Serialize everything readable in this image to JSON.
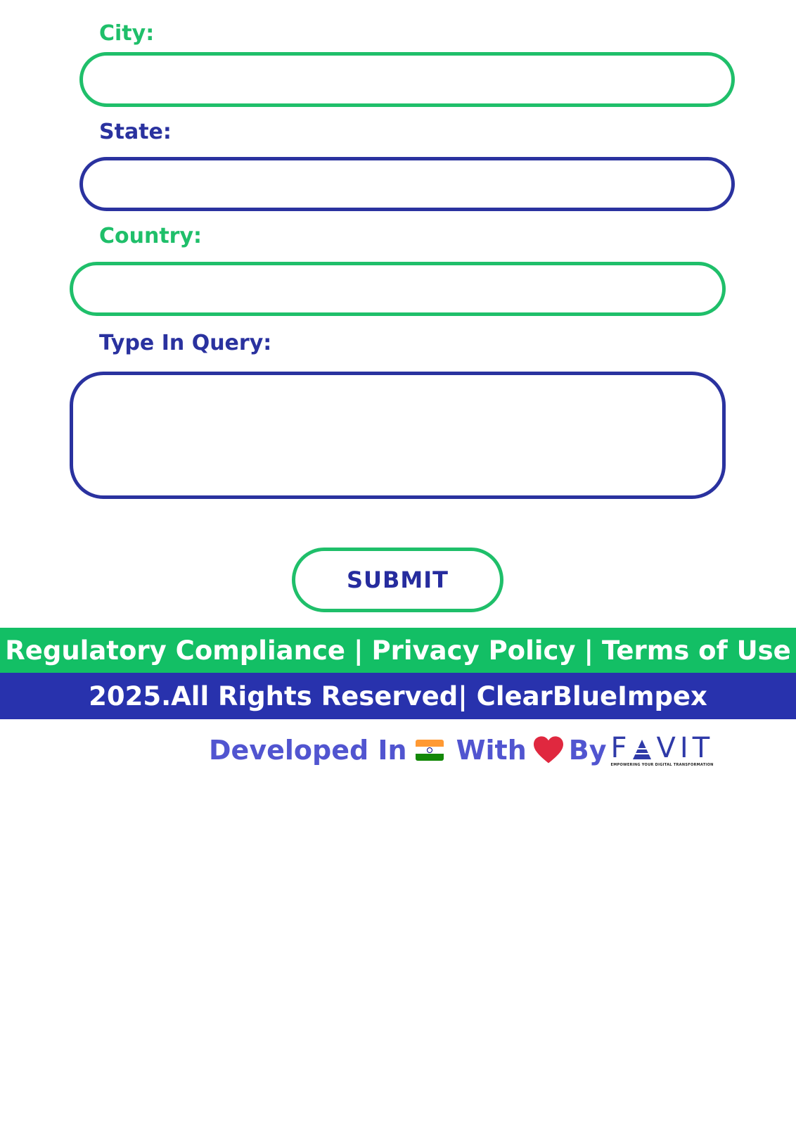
{
  "form": {
    "city_label": "City:",
    "city_value": "",
    "state_label": "State:",
    "state_value": "",
    "country_label": "Country:",
    "country_value": "",
    "query_label": "Type In Query:",
    "query_value": "",
    "submit_label": "SUBMIT"
  },
  "footer": {
    "links": [
      "Regulatory Compliance",
      "Privacy Policy",
      "Terms of Use"
    ],
    "separator": "|",
    "copyright": "2025.All Rights Reserved| ClearBlueImpex"
  },
  "credit": {
    "developed_in": "Developed In",
    "with": "With",
    "by": "By",
    "brand": "FAVIT",
    "brand_tagline": "EMPOWERING YOUR DIGITAL TRANSFORMATION",
    "flag_icon": "india-flag-icon",
    "heart_icon": "heart-icon"
  },
  "colors": {
    "green": "#1fbf6a",
    "blue": "#2a329f",
    "footer_green": "#13bf65",
    "footer_blue": "#2832ad",
    "credit_text": "#5155d0",
    "heart": "#e0283f"
  }
}
